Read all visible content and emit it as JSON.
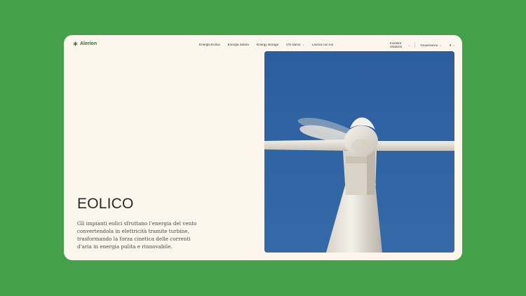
{
  "brand": {
    "name": "Alerion",
    "color": "#2f6a35"
  },
  "nav": {
    "items": [
      {
        "label": "Energia Eolica"
      },
      {
        "label": "Energia Solare"
      },
      {
        "label": "Energy storage"
      },
      {
        "label": "Chi siamo",
        "has_dropdown": true
      },
      {
        "label": "Lavora con noi"
      }
    ],
    "investor_relations": "Investor relations",
    "governance": "Governance",
    "language": "It"
  },
  "hero": {
    "title": "EOLICO",
    "description": "Gli impianti eolici sfruttano l'energia del vento convertendola in elettricità tramite turbine, trasformando la forza cinetica delle correnti d'aria in energia pulita e rinnovabile.",
    "image_subject": "wind turbine against blue sky"
  },
  "colors": {
    "background": "#45a04c",
    "page": "#fcf6ec",
    "sky": "#2f62a0",
    "text": "#2a2a2a"
  },
  "icons": [
    "alerion-logo-icon",
    "chevron-down-icon"
  ]
}
